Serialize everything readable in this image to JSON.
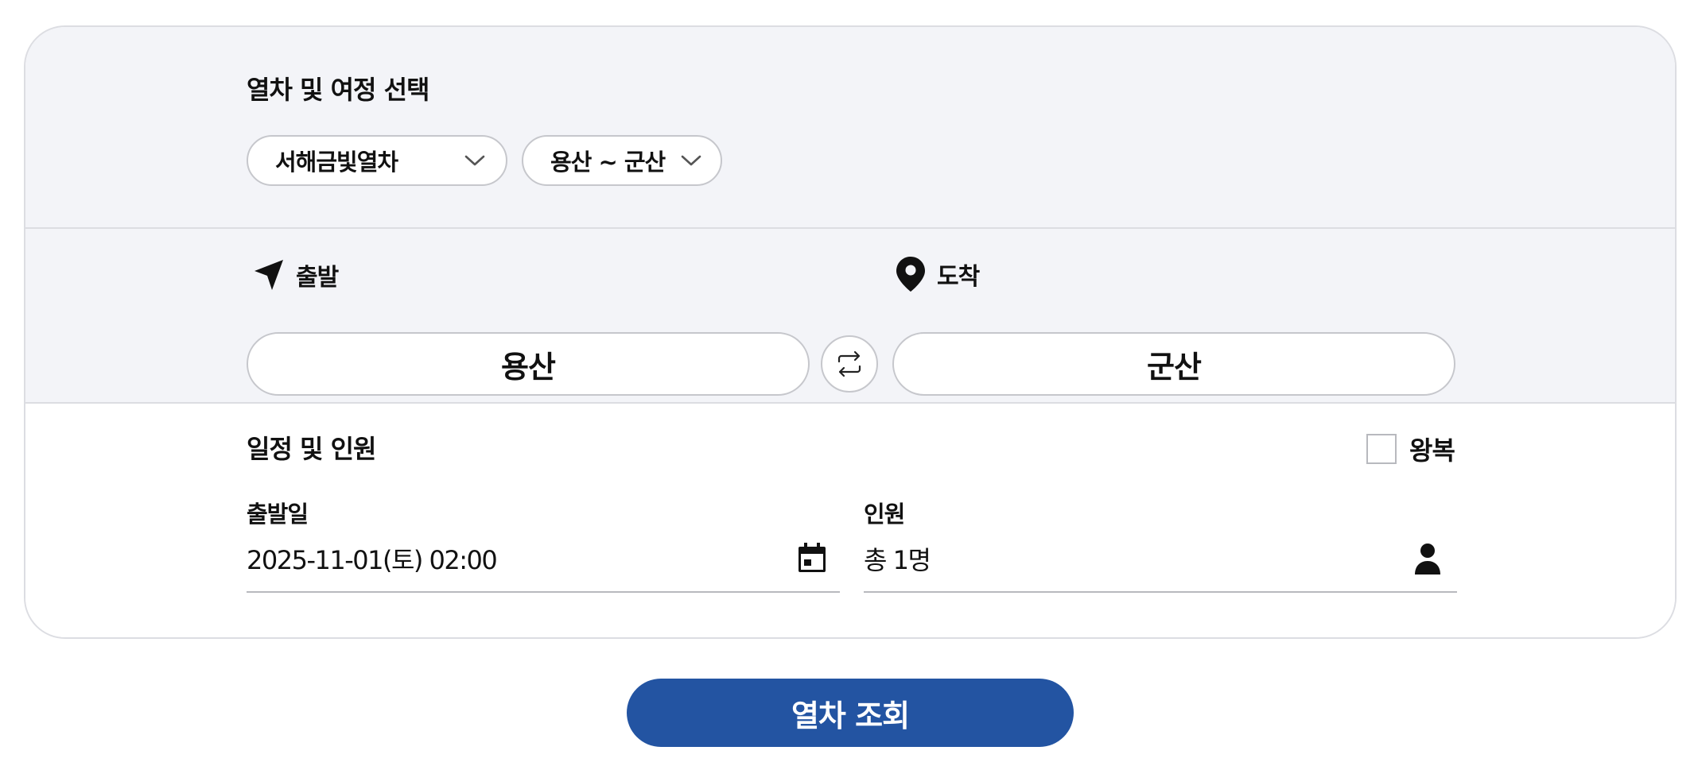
{
  "journey": {
    "title": "열차 및 여정 선택",
    "train_select": {
      "value": "서해금빛열차",
      "icon": "chevron-down-icon"
    },
    "route_select": {
      "value": "용산 ~ 군산",
      "icon": "chevron-down-icon"
    }
  },
  "stations": {
    "departure": {
      "label": "출발",
      "icon": "navigation-arrow-icon",
      "value": "용산"
    },
    "arrival": {
      "label": "도착",
      "icon": "location-pin-icon",
      "value": "군산"
    },
    "swap_icon": "swap-icon"
  },
  "schedule": {
    "title": "일정 및 인원",
    "roundtrip": {
      "label": "왕복",
      "checked": false
    },
    "date": {
      "label": "출발일",
      "value": "2025-11-01(토) 02:00",
      "icon": "calendar-icon"
    },
    "passengers": {
      "label": "인원",
      "value": "총 1명",
      "icon": "person-icon"
    }
  },
  "search_button": {
    "label": "열차 조회"
  },
  "colors": {
    "primary": "#2354a2",
    "section_bg": "#f3f4f8",
    "border": "#dcdde2"
  }
}
